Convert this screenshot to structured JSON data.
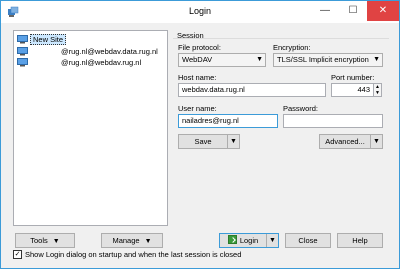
{
  "window": {
    "title": "Login",
    "minimize_glyph": "—",
    "maximize_glyph": "☐",
    "close_glyph": "✕"
  },
  "sites": [
    {
      "label": "New Site",
      "icon": "monitor-icon",
      "selected": true
    },
    {
      "label": "@rug.nl@webdav.data.rug.nl",
      "icon": "monitor-icon",
      "selected": false
    },
    {
      "label": "@rug.nl@webdav.rug.nl",
      "icon": "monitor-icon",
      "selected": false
    }
  ],
  "session": {
    "group_title": "Session",
    "file_protocol_label": "File protocol:",
    "file_protocol_value": "WebDAV",
    "encryption_label": "Encryption:",
    "encryption_value": "TLS/SSL Implicit encryption",
    "host_name_label": "Host name:",
    "host_name_value": "webdav.data.rug.nl",
    "port_label": "Port number:",
    "port_value": "443",
    "user_name_label": "User name:",
    "user_name_value": "nailadres@rug.nl",
    "password_label": "Password:",
    "password_value": "",
    "save_label": "Save",
    "advanced_label": "Advanced...",
    "dropdown_glyph": "▼",
    "spin_up_glyph": "▲",
    "spin_down_glyph": "▼"
  },
  "bottom": {
    "tools_label": "Tools",
    "manage_label": "Manage",
    "login_label": "Login",
    "close_label": "Close",
    "help_label": "Help"
  },
  "startup": {
    "checkbox_checked": true,
    "checkbox_glyph": "✓",
    "checkbox_label": "Show Login dialog on startup and when the last session is closed"
  },
  "colors": {
    "accent": "#3c9bd8",
    "close_button": "#e04343",
    "selection": "#cce8ff"
  }
}
